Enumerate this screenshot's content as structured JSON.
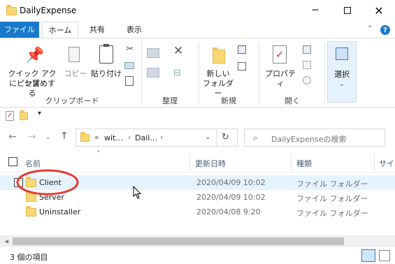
{
  "window": {
    "title": "DailyExpense"
  },
  "tabs": [
    {
      "label": "ファイル"
    },
    {
      "label": "ホーム"
    },
    {
      "label": "共有"
    },
    {
      "label": "表示"
    }
  ],
  "ribbon": {
    "pin_label_1": "クイック アクセス",
    "pin_label_2": "にピン留めする",
    "copy_label": "コピー",
    "paste_label": "貼り付け",
    "clipboard_group": "クリップボード",
    "organize_group": "整理",
    "newfolder_label_1": "新しい",
    "newfolder_label_2": "フォルダー",
    "new_group": "新規",
    "properties_label": "プロパティ",
    "open_group": "開く",
    "select_label": "選択"
  },
  "address": {
    "chevron": "«",
    "crumb1": "wit...",
    "crumb2": "Dail..."
  },
  "search": {
    "placeholder": "DailyExpenseの検索"
  },
  "columns": {
    "name": "名前",
    "date": "更新日時",
    "type": "種類",
    "size": "サイ"
  },
  "files": [
    {
      "name": "Client",
      "date": "2020/04/09 10:02",
      "type": "ファイル フォルダー"
    },
    {
      "name": "Server",
      "date": "2020/04/09 10:02",
      "type": "ファイル フォルダー"
    },
    {
      "name": "Uninstaller",
      "date": "2020/04/08 9:20",
      "type": "ファイル フォルダー"
    }
  ],
  "status": {
    "count": "3 個の項目"
  },
  "colors": {
    "file_tab": "#1979ca",
    "selection": "#cce8ff",
    "annotation": "#e53935",
    "folder": "#f8d775"
  }
}
